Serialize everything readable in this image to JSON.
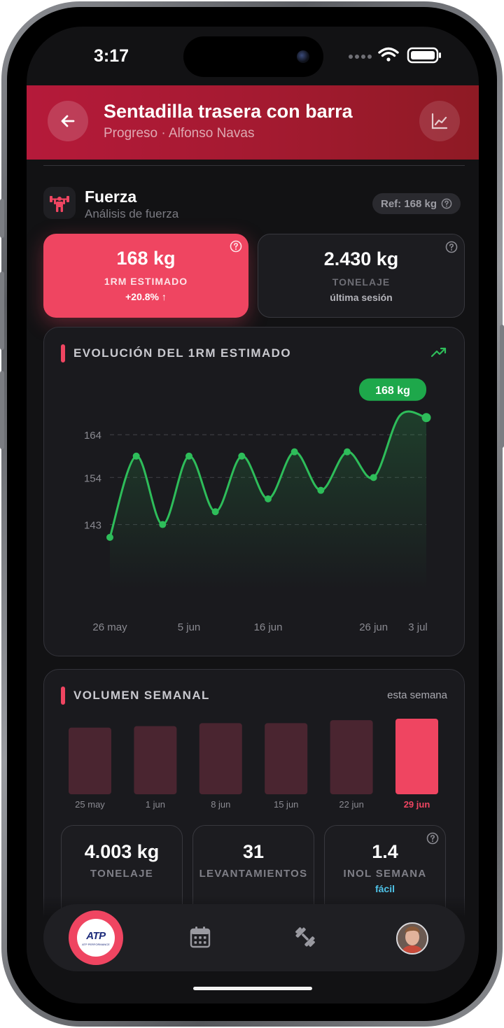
{
  "status_bar": {
    "time": "3:17"
  },
  "header": {
    "title": "Sentadilla trasera con barra",
    "subtitle": "Progreso · Alfonso Navas",
    "back_icon": "arrow-left-icon",
    "chart_icon": "line-chart-icon"
  },
  "section": {
    "title": "Fuerza",
    "subtitle": "Análisis de fuerza",
    "icon": "weightlifter-icon",
    "ref_badge": "Ref: 168 kg"
  },
  "stats": {
    "one_rm": {
      "value": "168 kg",
      "label": "1RM ESTIMADO",
      "change": "+20.8% ↑"
    },
    "tonnage": {
      "value": "2.430 kg",
      "label": "TONELAJE",
      "sub": "última sesión"
    }
  },
  "evolution": {
    "heading": "EVOLUCIÓN DEL 1RM ESTIMADO",
    "current_label": "168 kg"
  },
  "chart_data": [
    {
      "type": "line",
      "title": "EVOLUCIÓN DEL 1RM ESTIMADO",
      "x_ticks": [
        "26 may",
        "5 jun",
        "16 jun",
        "26 jun",
        "3 jul"
      ],
      "y_ticks": [
        143,
        154,
        164
      ],
      "x": [
        "26 may",
        "29 may",
        "1 jun",
        "5 jun",
        "8 jun",
        "11 jun",
        "14 jun",
        "17 jun",
        "20 jun",
        "23 jun",
        "26 jun",
        "29 jun",
        "3 jul"
      ],
      "values": [
        140,
        159,
        143,
        159,
        146,
        159,
        149,
        160,
        151,
        160,
        154,
        168.5,
        168
      ],
      "point_y": [
        140,
        159,
        143,
        159,
        146,
        159,
        149,
        160,
        151,
        160,
        154,
        168.5
      ],
      "last_label": "168 kg",
      "ylim": [
        130,
        175
      ],
      "grid": true,
      "color": "#2ebd5a"
    },
    {
      "type": "bar",
      "title": "VOLUMEN SEMANAL",
      "categories": [
        "25 may",
        "1 jun",
        "8 jun",
        "15 jun",
        "22 jun",
        "29 jun"
      ],
      "values": [
        0.9,
        0.92,
        0.96,
        0.96,
        1.0,
        1.02
      ],
      "highlight_index": 5,
      "colors": {
        "bar": "#4a2530",
        "highlight": "#ef4561"
      }
    }
  ],
  "volume": {
    "heading": "VOLUMEN SEMANAL",
    "note": "esta semana",
    "cards": [
      {
        "value": "4.003 kg",
        "label": "TONELAJE",
        "sub": ""
      },
      {
        "value": "31",
        "label": "LEVANTAMIENTOS",
        "sub": ""
      },
      {
        "value": "1.4",
        "label": "INOL SEMANA",
        "sub": "fácil"
      }
    ]
  },
  "nav": {
    "logo_text": "ATP",
    "logo_sub": "ATP PERFORMANCE",
    "items": [
      "home",
      "calendar-icon",
      "dumbbell-icon",
      "avatar"
    ]
  },
  "colors": {
    "accent": "#ef4561",
    "header": "#b51a3a",
    "green": "#2ebd5a",
    "info": "#4fc3e8"
  }
}
